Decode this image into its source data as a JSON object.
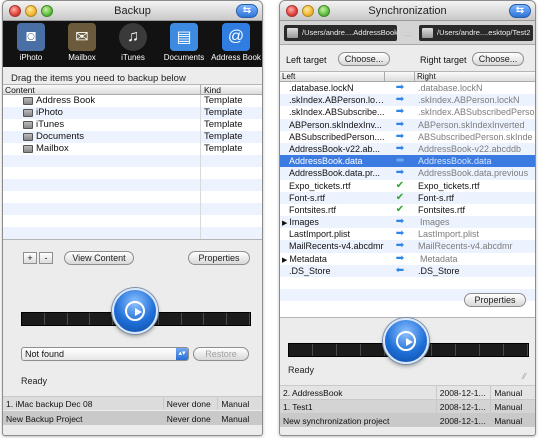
{
  "backup_window": {
    "title": "Backup",
    "toolbar": [
      {
        "label": "iPhoto",
        "icon": "iphoto-icon",
        "color": "#4a6fa5"
      },
      {
        "label": "Mailbox",
        "icon": "mailbox-icon",
        "color": "#6b5a3c"
      },
      {
        "label": "iTunes",
        "icon": "itunes-icon",
        "color": "#3a3a3a"
      },
      {
        "label": "Documents",
        "icon": "documents-icon",
        "color": "#3d8be0"
      },
      {
        "label": "Address Book",
        "icon": "address-book-icon",
        "color": "#2f7de0"
      }
    ],
    "hint": "Drag the items you need to backup below",
    "columns": {
      "content": "Content",
      "kind": "Kind"
    },
    "items": [
      {
        "name": "Address Book",
        "kind": "Template"
      },
      {
        "name": "iPhoto",
        "kind": "Template"
      },
      {
        "name": "iTunes",
        "kind": "Template"
      },
      {
        "name": "Documents",
        "kind": "Template"
      },
      {
        "name": "Mailbox",
        "kind": "Template"
      }
    ],
    "buttons": {
      "add": "+",
      "remove": "-",
      "view_content": "View Content",
      "properties": "Properties",
      "restore": "Restore"
    },
    "select_value": "Not found",
    "status": "Ready",
    "projects": [
      {
        "name": "1. iMac backup Dec 08",
        "last": "Never done",
        "mode": "Manual"
      },
      {
        "name": "New Backup Project",
        "last": "Never done",
        "mode": "Manual"
      }
    ]
  },
  "sync_window": {
    "title": "Synchronization",
    "left_path": "/Users/andre....AddressBook",
    "right_path": "/Users/andre....esktop/Test2",
    "left_target_label": "Left target",
    "right_target_label": "Right target",
    "choose": "Choose...",
    "columns": {
      "left": "Left",
      "right": "Right"
    },
    "rows": [
      {
        "left": ".database.lockN",
        "dir": "right",
        "right": ".database.lockN",
        "right_dark": false,
        "folder": false,
        "selected": false
      },
      {
        "left": ".skIndex.ABPerson.lockN",
        "dir": "right",
        "right": ".skIndex.ABPerson.lockN",
        "right_dark": false,
        "folder": false,
        "selected": false
      },
      {
        "left": ".skIndex.ABSubscribe...",
        "dir": "right",
        "right": ".skIndex.ABSubscribedPerso",
        "right_dark": false,
        "folder": false,
        "selected": false
      },
      {
        "left": "ABPerson.skIndexInv...",
        "dir": "right",
        "right": "ABPerson.skIndexInverted",
        "right_dark": false,
        "folder": false,
        "selected": false
      },
      {
        "left": "ABSubscribedPerson....",
        "dir": "right",
        "right": "ABSubscribedPerson.skInde",
        "right_dark": false,
        "folder": false,
        "selected": false
      },
      {
        "left": "AddressBook-v22.ab...",
        "dir": "right",
        "right": "AddressBook-v22.abcddb",
        "right_dark": false,
        "folder": false,
        "selected": false
      },
      {
        "left": "AddressBook.data",
        "dir": "equal",
        "right": "AddressBook.data",
        "right_dark": false,
        "folder": false,
        "selected": true
      },
      {
        "left": "AddressBook.data.pr...",
        "dir": "right",
        "right": "AddressBook.data.previous",
        "right_dark": false,
        "folder": false,
        "selected": false
      },
      {
        "left": "Expo_tickets.rtf",
        "dir": "check",
        "right": "Expo_tickets.rtf",
        "right_dark": true,
        "folder": false,
        "selected": false
      },
      {
        "left": "Font-s.rtf",
        "dir": "check",
        "right": "Font-s.rtf",
        "right_dark": true,
        "folder": false,
        "selected": false
      },
      {
        "left": "Fontsites.rtf",
        "dir": "check",
        "right": "Fontsites.rtf",
        "right_dark": true,
        "folder": false,
        "selected": false
      },
      {
        "left": "Images",
        "dir": "right",
        "right": "Images",
        "right_dark": false,
        "folder": true,
        "selected": false
      },
      {
        "left": "LastImport.plist",
        "dir": "right",
        "right": "LastImport.plist",
        "right_dark": false,
        "folder": false,
        "selected": false
      },
      {
        "left": "MailRecents-v4.abcdmr",
        "dir": "right",
        "right": "MailRecents-v4.abcdmr",
        "right_dark": false,
        "folder": false,
        "selected": false
      },
      {
        "left": "Metadata",
        "dir": "right",
        "right": "Metadata",
        "right_dark": false,
        "folder": true,
        "selected": false
      },
      {
        "left": ".DS_Store",
        "dir": "left",
        "right": ".DS_Store",
        "right_dark": true,
        "folder": false,
        "selected": false
      }
    ],
    "properties": "Properties",
    "status": "Ready",
    "projects": [
      {
        "name": "2. AddressBook",
        "date": "2008-12-1...",
        "mode": "Manual"
      },
      {
        "name": "1. Test1",
        "date": "2008-12-1...",
        "mode": "Manual"
      },
      {
        "name": "New synchronization project",
        "date": "2008-12-1...",
        "mode": "Manual"
      }
    ]
  },
  "colors": {
    "accent": "#3b7ae0",
    "arrow": "#2b86e8",
    "check": "#2ea32e"
  }
}
